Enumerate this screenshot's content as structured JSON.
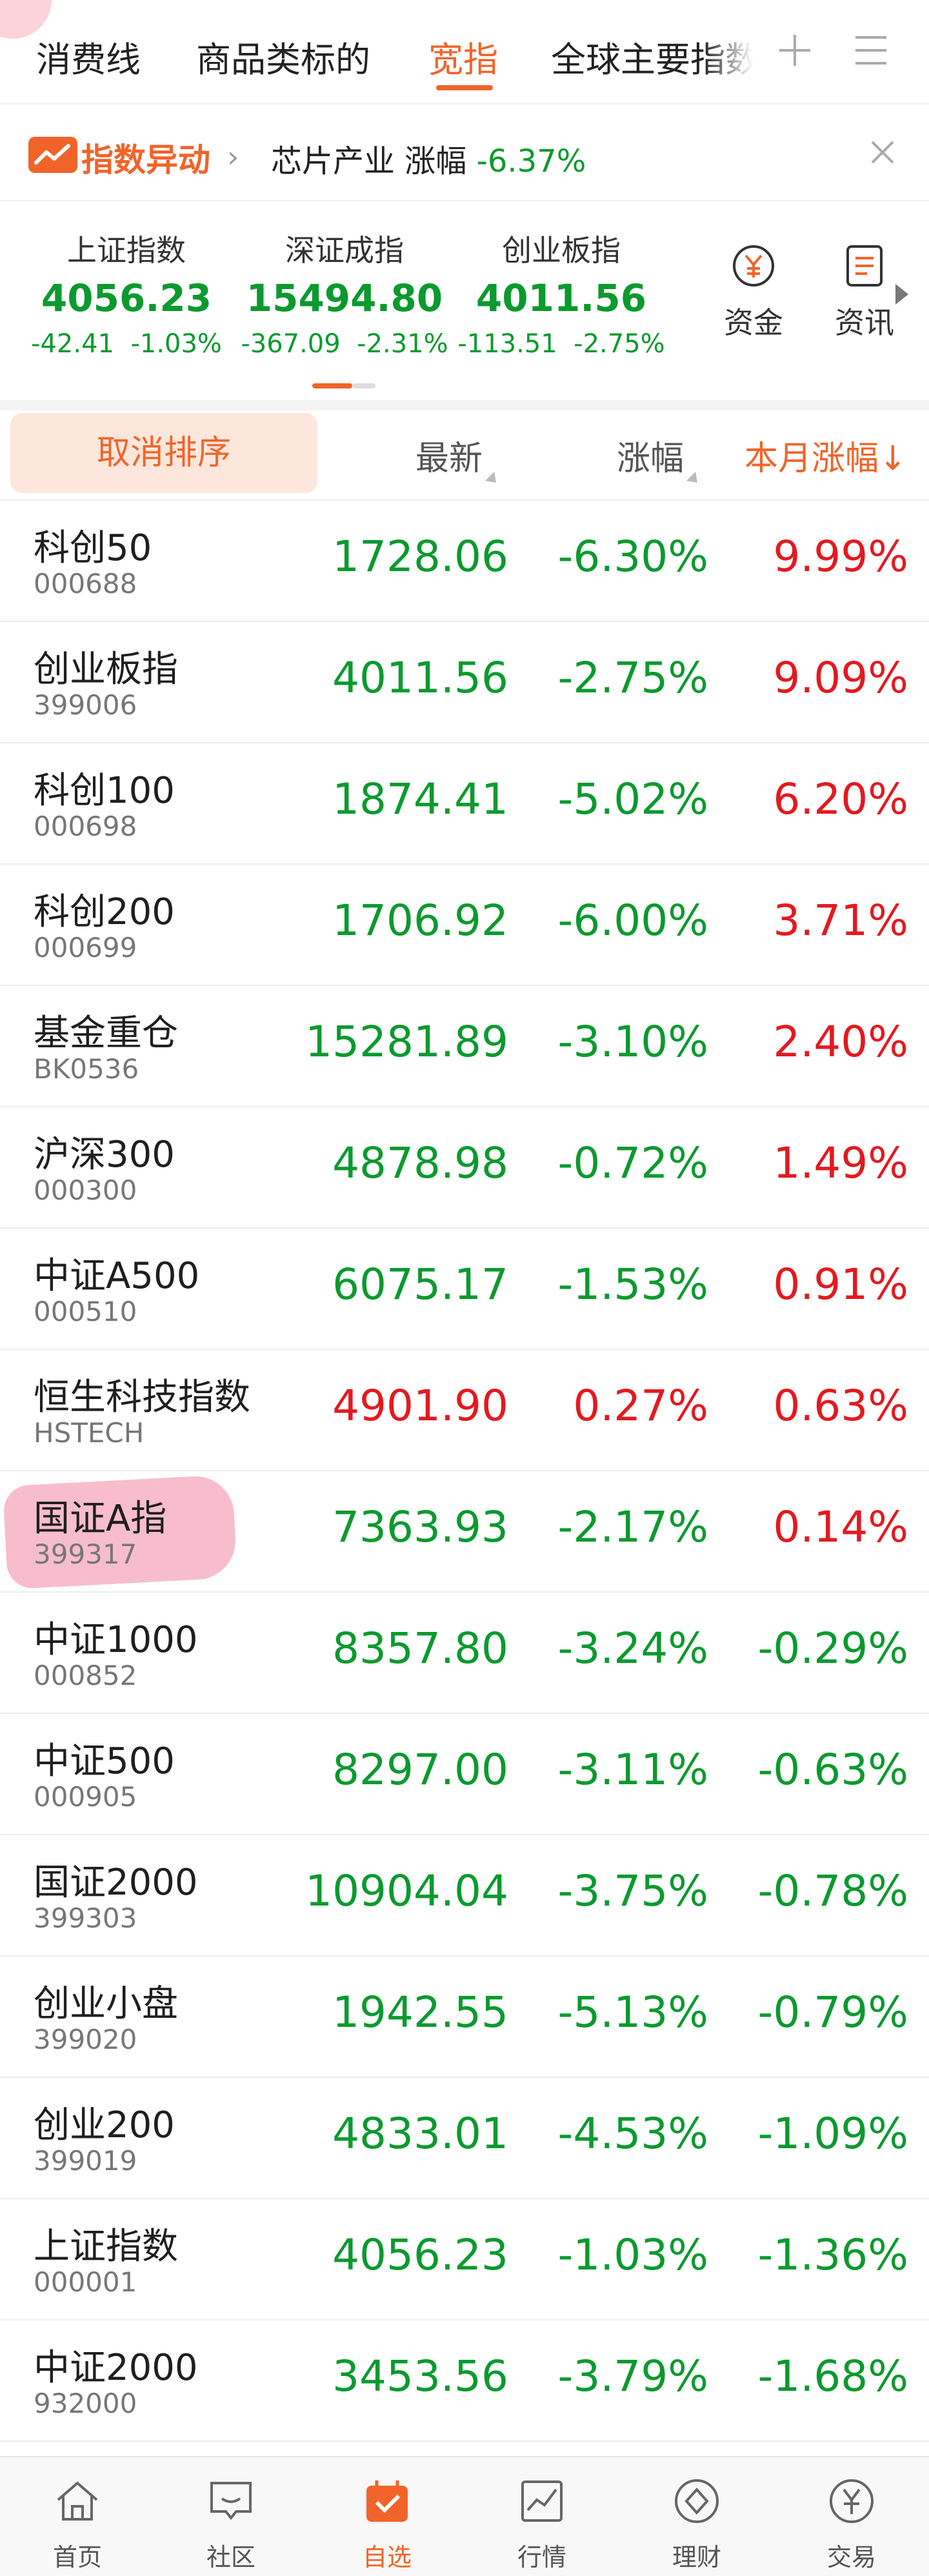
{
  "tabs": [
    {
      "label": "消费线"
    },
    {
      "label": "商品类标的"
    },
    {
      "label": "宽指",
      "active": true
    },
    {
      "label": "全球主要指数"
    }
  ],
  "alert": {
    "title": "指数异动",
    "sector": "芯片产业",
    "metric": "涨幅",
    "change": "-6.37%"
  },
  "indices": [
    {
      "name": "上证指数",
      "value": "4056.23",
      "change": "-42.41",
      "pct": "-1.03%"
    },
    {
      "name": "深证成指",
      "value": "15494.80",
      "change": "-367.09",
      "pct": "-2.31%"
    },
    {
      "name": "创业板指",
      "value": "4011.56",
      "change": "-113.51",
      "pct": "-2.75%"
    }
  ],
  "side_buttons": {
    "funds": "资金",
    "news": "资讯"
  },
  "columns": {
    "cancel_sort": "取消排序",
    "latest": "最新",
    "change": "涨幅",
    "month_change": "本月涨幅↓"
  },
  "rows": [
    {
      "name": "科创50",
      "code": "000688",
      "price": "1728.06",
      "change": "-6.30%",
      "month": "9.99%"
    },
    {
      "name": "创业板指",
      "code": "399006",
      "price": "4011.56",
      "change": "-2.75%",
      "month": "9.09%"
    },
    {
      "name": "科创100",
      "code": "000698",
      "price": "1874.41",
      "change": "-5.02%",
      "month": "6.20%"
    },
    {
      "name": "科创200",
      "code": "000699",
      "price": "1706.92",
      "change": "-6.00%",
      "month": "3.71%"
    },
    {
      "name": "基金重仓",
      "code": "BK0536",
      "price": "15281.89",
      "change": "-3.10%",
      "month": "2.40%"
    },
    {
      "name": "沪深300",
      "code": "000300",
      "price": "4878.98",
      "change": "-0.72%",
      "month": "1.49%"
    },
    {
      "name": "中证A500",
      "code": "000510",
      "price": "6075.17",
      "change": "-1.53%",
      "month": "0.91%"
    },
    {
      "name": "恒生科技指数",
      "code": "HSTECH",
      "price": "4901.90",
      "change": "0.27%",
      "month": "0.63%"
    },
    {
      "name": "国证A指",
      "code": "399317",
      "price": "7363.93",
      "change": "-2.17%",
      "month": "0.14%"
    },
    {
      "name": "中证1000",
      "code": "000852",
      "price": "8357.80",
      "change": "-3.24%",
      "month": "-0.29%"
    },
    {
      "name": "中证500",
      "code": "000905",
      "price": "8297.00",
      "change": "-3.11%",
      "month": "-0.63%"
    },
    {
      "name": "国证2000",
      "code": "399303",
      "price": "10904.04",
      "change": "-3.75%",
      "month": "-0.78%"
    },
    {
      "name": "创业小盘",
      "code": "399020",
      "price": "1942.55",
      "change": "-5.13%",
      "month": "-0.79%"
    },
    {
      "name": "创业200",
      "code": "399019",
      "price": "4833.01",
      "change": "-4.53%",
      "month": "-1.09%"
    },
    {
      "name": "上证指数",
      "code": "000001",
      "price": "4056.23",
      "change": "-1.03%",
      "month": "-1.36%"
    },
    {
      "name": "中证2000",
      "code": "932000",
      "price": "3453.56",
      "change": "-3.79%",
      "month": "-1.68%"
    }
  ],
  "nav": [
    {
      "label": "首页",
      "icon": "home-icon"
    },
    {
      "label": "社区",
      "icon": "community-icon"
    },
    {
      "label": "自选",
      "icon": "watchlist-icon",
      "active": true
    },
    {
      "label": "行情",
      "icon": "market-icon"
    },
    {
      "label": "理财",
      "icon": "wealth-icon"
    },
    {
      "label": "交易",
      "icon": "trade-icon"
    }
  ],
  "colors": {
    "accent": "#f0642a",
    "up": "#e4191f",
    "down": "#0a9a2e"
  }
}
